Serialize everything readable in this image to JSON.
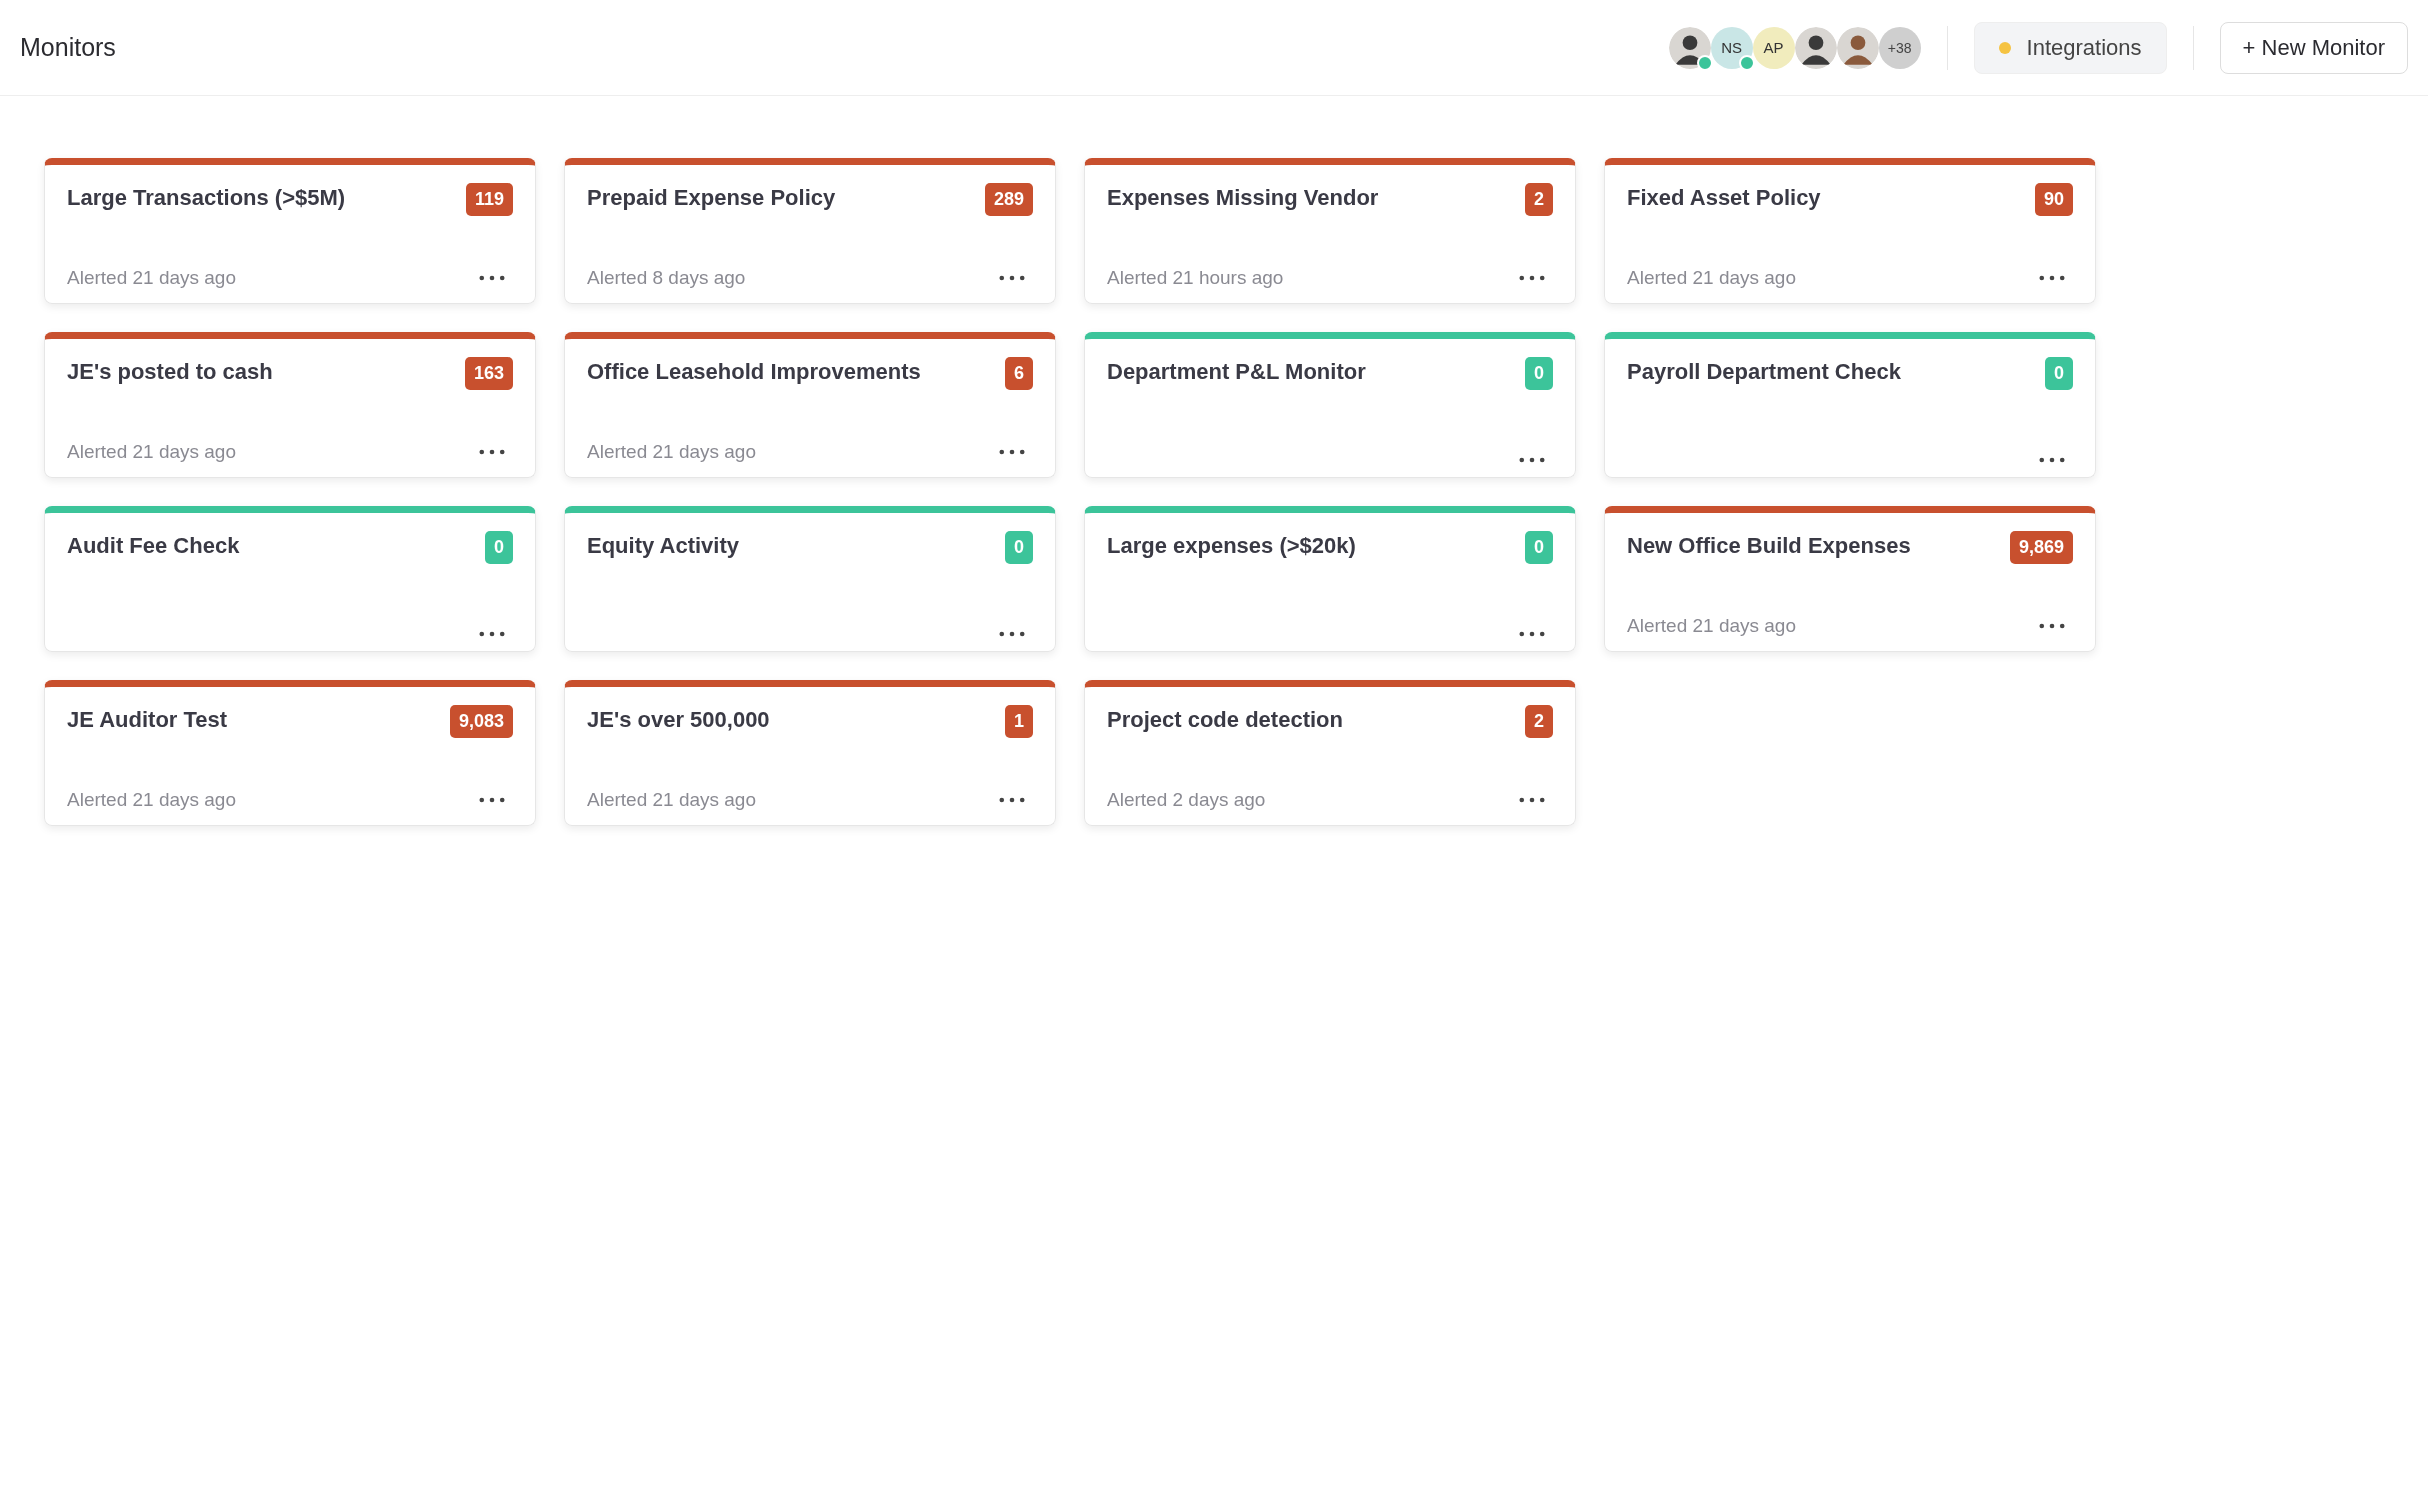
{
  "header": {
    "title": "Monitors",
    "avatars": [
      {
        "kind": "photo",
        "online": true
      },
      {
        "kind": "initials",
        "text": "NS",
        "color": "#c9e6e6",
        "online": true
      },
      {
        "kind": "initials",
        "text": "AP",
        "color": "#f1ecbd",
        "online": false
      },
      {
        "kind": "photo",
        "online": false
      },
      {
        "kind": "photo",
        "online": false
      },
      {
        "kind": "count",
        "text": "+38",
        "color": "#cfcfcf",
        "online": false
      }
    ],
    "integrations_button": "Integrations",
    "new_button": "+ New Monitor"
  },
  "monitors": [
    {
      "name": "Large Transactions (>$5M)",
      "color": "#c8502e",
      "count": "119",
      "alerted": "Alerted 21 days ago"
    },
    {
      "name": "Prepaid Expense Policy",
      "color": "#c8502e",
      "count": "289",
      "alerted": "Alerted 8 days ago"
    },
    {
      "name": "Expenses Missing Vendor",
      "color": "#c8502e",
      "count": "2",
      "alerted": "Alerted 21 hours ago"
    },
    {
      "name": "Fixed Asset Policy",
      "color": "#c8502e",
      "count": "90",
      "alerted": "Alerted 21 days ago"
    },
    {
      "name": "JE's posted to cash",
      "color": "#c8502e",
      "count": "163",
      "alerted": "Alerted 21 days ago"
    },
    {
      "name": "Office Leasehold Improvements",
      "color": "#c8502e",
      "count": "6",
      "alerted": "Alerted 21 days ago"
    },
    {
      "name": "Department P&L Monitor",
      "color": "#3cc49a",
      "count": "0"
    },
    {
      "name": "Payroll Department Check",
      "color": "#3cc49a",
      "count": "0"
    },
    {
      "name": "Audit Fee Check",
      "color": "#3cc49a",
      "count": "0"
    },
    {
      "name": "Equity Activity",
      "color": "#3cc49a",
      "count": "0"
    },
    {
      "name": "Large expenses (>$20k)",
      "color": "#3cc49a",
      "count": "0"
    },
    {
      "name": "New Office Build Expenses",
      "color": "#c8502e",
      "count": "9,869",
      "alerted": "Alerted 21 days ago"
    },
    {
      "name": "JE Auditor Test",
      "color": "#c8502e",
      "count": "9,083",
      "alerted": "Alerted 21 days ago"
    },
    {
      "name": "JE's over 500,000",
      "color": "#c8502e",
      "count": "1",
      "alerted": "Alerted 21 days ago"
    },
    {
      "name": "Project code detection",
      "color": "#c8502e",
      "count": "2",
      "alerted": "Alerted 2 days ago"
    }
  ]
}
